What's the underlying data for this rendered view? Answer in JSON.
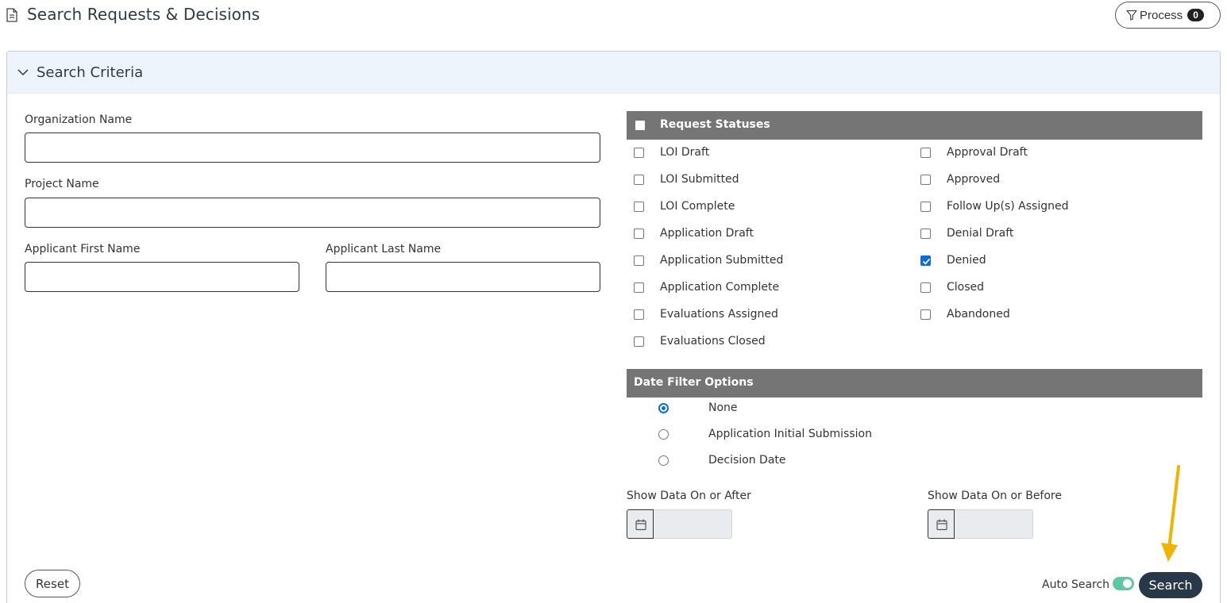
{
  "header": {
    "title": "Search Requests & Decisions",
    "process_label": "Process",
    "process_count": "0"
  },
  "panel": {
    "title": "Search Criteria"
  },
  "fields": {
    "organization_name": {
      "label": "Organization Name",
      "value": ""
    },
    "project_name": {
      "label": "Project Name",
      "value": ""
    },
    "applicant_first_name": {
      "label": "Applicant First Name",
      "value": ""
    },
    "applicant_last_name": {
      "label": "Applicant Last Name",
      "value": ""
    }
  },
  "request_statuses": {
    "title": "Request Statuses",
    "left": [
      {
        "label": "LOI Draft",
        "checked": false
      },
      {
        "label": "LOI Submitted",
        "checked": false
      },
      {
        "label": "LOI Complete",
        "checked": false
      },
      {
        "label": "Application Draft",
        "checked": false
      },
      {
        "label": "Application Submitted",
        "checked": false
      },
      {
        "label": "Application Complete",
        "checked": false
      },
      {
        "label": "Evaluations Assigned",
        "checked": false
      },
      {
        "label": "Evaluations Closed",
        "checked": false
      }
    ],
    "right": [
      {
        "label": "Approval Draft",
        "checked": false
      },
      {
        "label": "Approved",
        "checked": false
      },
      {
        "label": "Follow Up(s) Assigned",
        "checked": false
      },
      {
        "label": "Denial Draft",
        "checked": false
      },
      {
        "label": "Denied",
        "checked": true
      },
      {
        "label": "Closed",
        "checked": false
      },
      {
        "label": "Abandoned",
        "checked": false
      }
    ]
  },
  "date_filter": {
    "title": "Date Filter Options",
    "options": [
      {
        "label": "None",
        "selected": true
      },
      {
        "label": "Application Initial Submission",
        "selected": false
      },
      {
        "label": "Decision Date",
        "selected": false
      }
    ],
    "after_label": "Show Data On or After",
    "before_label": "Show Data On or Before"
  },
  "footer": {
    "reset_label": "Reset",
    "auto_search_label": "Auto Search",
    "auto_search_on": true,
    "search_label": "Search"
  },
  "colors": {
    "accent": "#0b6bdb",
    "section_bar": "#757575",
    "search_button": "#283848",
    "toggle_on": "#5cc9a0",
    "arrow": "#f0b400"
  }
}
